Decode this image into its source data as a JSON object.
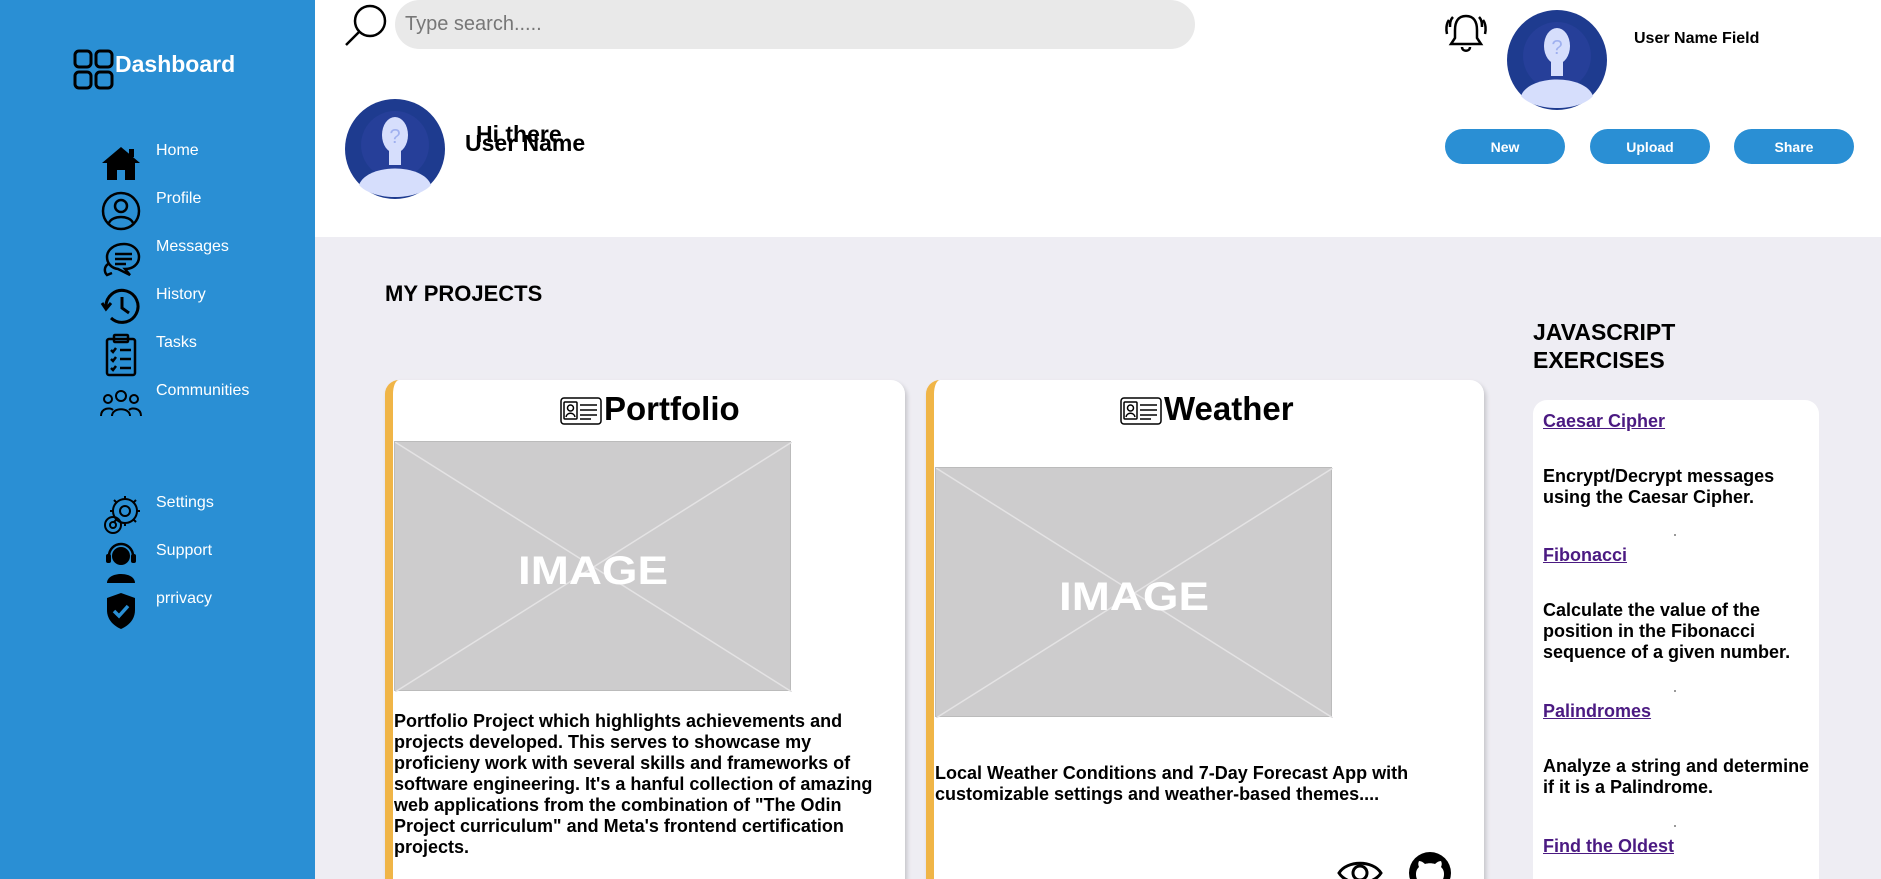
{
  "sidebar": {
    "brand": "Dashboard",
    "items": [
      {
        "label": "Home",
        "icon": "home-icon"
      },
      {
        "label": "Profile",
        "icon": "profile-icon"
      },
      {
        "label": "Messages",
        "icon": "messages-icon"
      },
      {
        "label": "History",
        "icon": "history-icon"
      },
      {
        "label": "Tasks",
        "icon": "tasks-icon"
      },
      {
        "label": "Communities",
        "icon": "communities-icon"
      }
    ],
    "bottom_items": [
      {
        "label": "Settings",
        "icon": "settings-icon"
      },
      {
        "label": "Support",
        "icon": "support-icon"
      },
      {
        "label": "prrivacy",
        "icon": "privacy-shield-icon"
      }
    ]
  },
  "header": {
    "search_placeholder": "Type search.....",
    "user_name_field": "User Name Field",
    "greeting": "Hi there",
    "user_name": "User Name",
    "buttons": {
      "new": "New",
      "upload": "Upload",
      "share": "Share"
    }
  },
  "main": {
    "section_title": "MY PROJECTS",
    "projects": [
      {
        "title": "Portfolio",
        "image_label": "IMAGE",
        "description": "Portfolio Project which highlights achievements and projects developed. This serves to showcase my proficieny work with several skills and frameworks of software engineering. It's a hanful collection of amazing web applications from the combination of \"The Odin Project curriculum\" and Meta's frontend certification projects."
      },
      {
        "title": "Weather",
        "image_label": "IMAGE",
        "description": "Local Weather Conditions and 7-Day Forecast App with customizable settings and weather-based themes...."
      }
    ]
  },
  "exercises": {
    "title": "JAVASCRIPT EXERCISES",
    "items": [
      {
        "name": "Caesar Cipher",
        "description": "Encrypt/Decrypt messages using the Caesar Cipher."
      },
      {
        "name": "Fibonacci",
        "description": "Calculate the value of the position in the Fibonacci sequence of a given number."
      },
      {
        "name": "Palindromes",
        "description": "Analyze a string and determine if it is a Palindrome."
      },
      {
        "name": "Find the Oldest",
        "description": ""
      }
    ]
  },
  "colors": {
    "sidebar": "#2a8fd4",
    "accent": "#f0b547",
    "link": "#4b1a82",
    "background": "#eeedf3"
  }
}
